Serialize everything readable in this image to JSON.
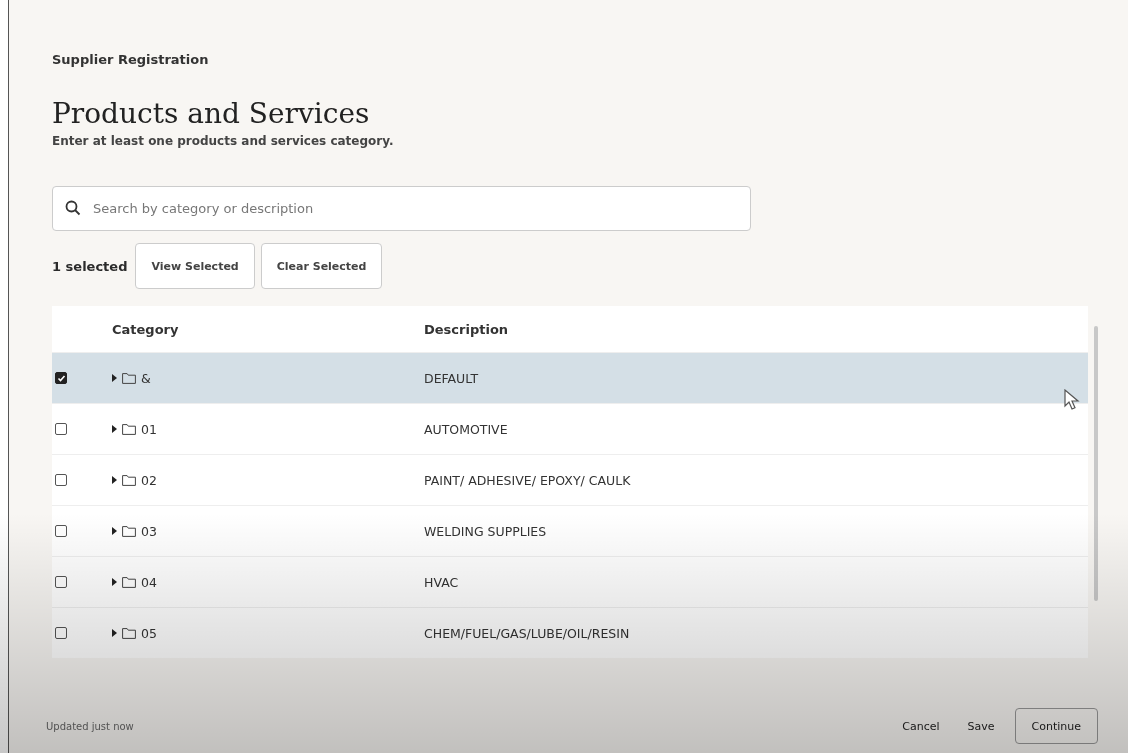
{
  "breadcrumb": "Supplier Registration",
  "page_title": "Products and Services",
  "instructions": "Enter at least one products and services category.",
  "search": {
    "placeholder": "Search by category or description"
  },
  "selection": {
    "count": "1 selected",
    "buttons": [
      "View Selected",
      "Clear Selected"
    ]
  },
  "table": {
    "columns": [
      "Category",
      "Description"
    ],
    "rows": [
      {
        "category": "&",
        "description": "DEFAULT",
        "selected": true
      },
      {
        "category": "01",
        "description": "AUTOMOTIVE",
        "selected": false
      },
      {
        "category": "02",
        "description": "PAINT/ ADHESIVE/ EPOXY/ CAULK",
        "selected": false
      },
      {
        "category": "03",
        "description": "WELDING SUPPLIES",
        "selected": false
      },
      {
        "category": "04",
        "description": "HVAC",
        "selected": false
      },
      {
        "category": "05",
        "description": "CHEM/FUEL/GAS/LUBE/OIL/RESIN",
        "selected": false
      }
    ]
  },
  "footer": {
    "status": "Updated just now",
    "buttons": [
      {
        "label": "Cancel",
        "kind": "plain"
      },
      {
        "label": "Save",
        "kind": "plain"
      },
      {
        "label": "Continue",
        "kind": "outlined"
      }
    ]
  }
}
